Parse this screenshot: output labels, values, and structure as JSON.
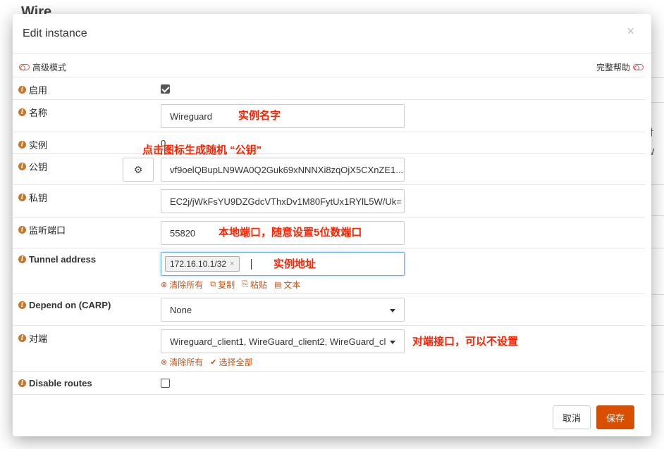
{
  "background": {
    "title": "Wire",
    "frag1": "对",
    "frag2": "W"
  },
  "modal": {
    "title": "Edit instance",
    "close": "×"
  },
  "toggles": {
    "advanced_mode": "高级模式",
    "full_help": "完整帮助"
  },
  "fields": {
    "enabled": {
      "label": "启用",
      "checked": true
    },
    "name": {
      "label": "名称",
      "value": "Wireguard",
      "annotation": "实例名字"
    },
    "instance": {
      "label": "实例",
      "value": "0",
      "annotation": "点击图标生成随机 “公钥”"
    },
    "public_key": {
      "label": "公钥",
      "value": "vf9oelQBupLN9WA0Q2Guk69xNNNXi8zqOjX5CXnZE1...",
      "gear_icon": "gear-icon"
    },
    "private_key": {
      "label": "私钥",
      "value": "EC2j/jWkFsYU9DZGdcVThxDv1M80FytUx1RYlL5W/Uk="
    },
    "listen_port": {
      "label": "监听端口",
      "value": "55820",
      "annotation": "本地端口，随意设置5位数端口"
    },
    "tunnel_address": {
      "label": "Tunnel address",
      "tag": "172.16.10.1/32",
      "tag_remove": "×",
      "annotation": "实例地址",
      "tools": {
        "clear_all": "清除所有",
        "copy": "复制",
        "paste": "粘贴",
        "text": "文本"
      }
    },
    "depend_on": {
      "label": "Depend on (CARP)",
      "value": "None"
    },
    "peers": {
      "label": "对端",
      "value": "Wireguard_client1, WireGuard_client2, WireGuard_cl",
      "annotation": "对端接口，可以不设置",
      "tools": {
        "clear_all": "清除所有",
        "select_all": "选择全部"
      }
    },
    "disable_routes": {
      "label": "Disable routes",
      "checked": false
    }
  },
  "footer": {
    "cancel": "取消",
    "save": "保存"
  },
  "colors": {
    "accent": "#d94f00",
    "annotation": "#ff2200",
    "info_icon": "#c9752a"
  }
}
